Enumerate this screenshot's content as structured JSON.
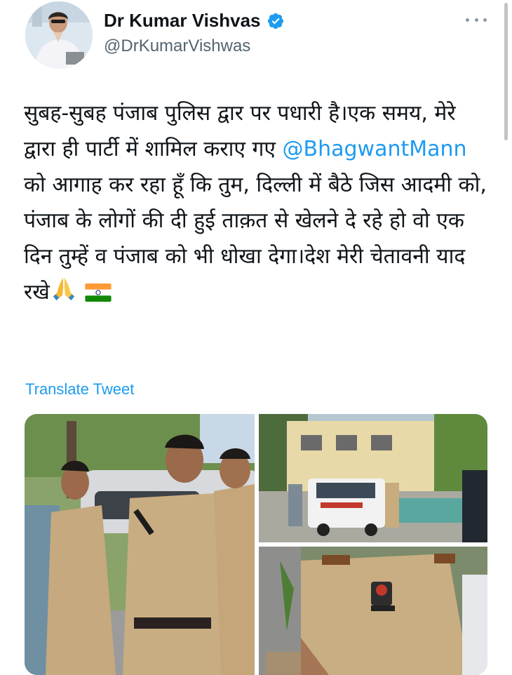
{
  "author": {
    "display_name": "Dr Kumar Vishvas",
    "handle": "@DrKumarVishwas",
    "verified": true
  },
  "tweet": {
    "text_before_mention": "सुबह-सुबह पंजाब पुलिस द्वार पर पधारी है।एक समय, मेरे द्वारा ही पार्टी में शामिल कराए गए ",
    "mention": "@BhagwantMann",
    "text_after_mention": " को आगाह कर रहा हूँ कि तुम, दिल्ली में बैठे जिस आदमी को, पंजाब के लोगों की दी हुई ताक़त से खेलने दे रहे हो वो एक दिन तुम्हें व पंजाब को भी धोखा देगा।देश मेरी चेतावनी याद रखे",
    "emojis": [
      "folded-hands-emoji",
      "india-flag-emoji"
    ]
  },
  "translate_label": "Translate Tweet",
  "media": {
    "photos": [
      {
        "name": "photo-police-officers"
      },
      {
        "name": "photo-police-vehicle-building"
      },
      {
        "name": "photo-officer-closeup"
      }
    ]
  },
  "icons": {
    "verified": "verified-badge-icon",
    "more": "more-options-icon"
  },
  "colors": {
    "accent": "#1d9bf0",
    "text": "#0f1419",
    "secondary": "#536471"
  }
}
